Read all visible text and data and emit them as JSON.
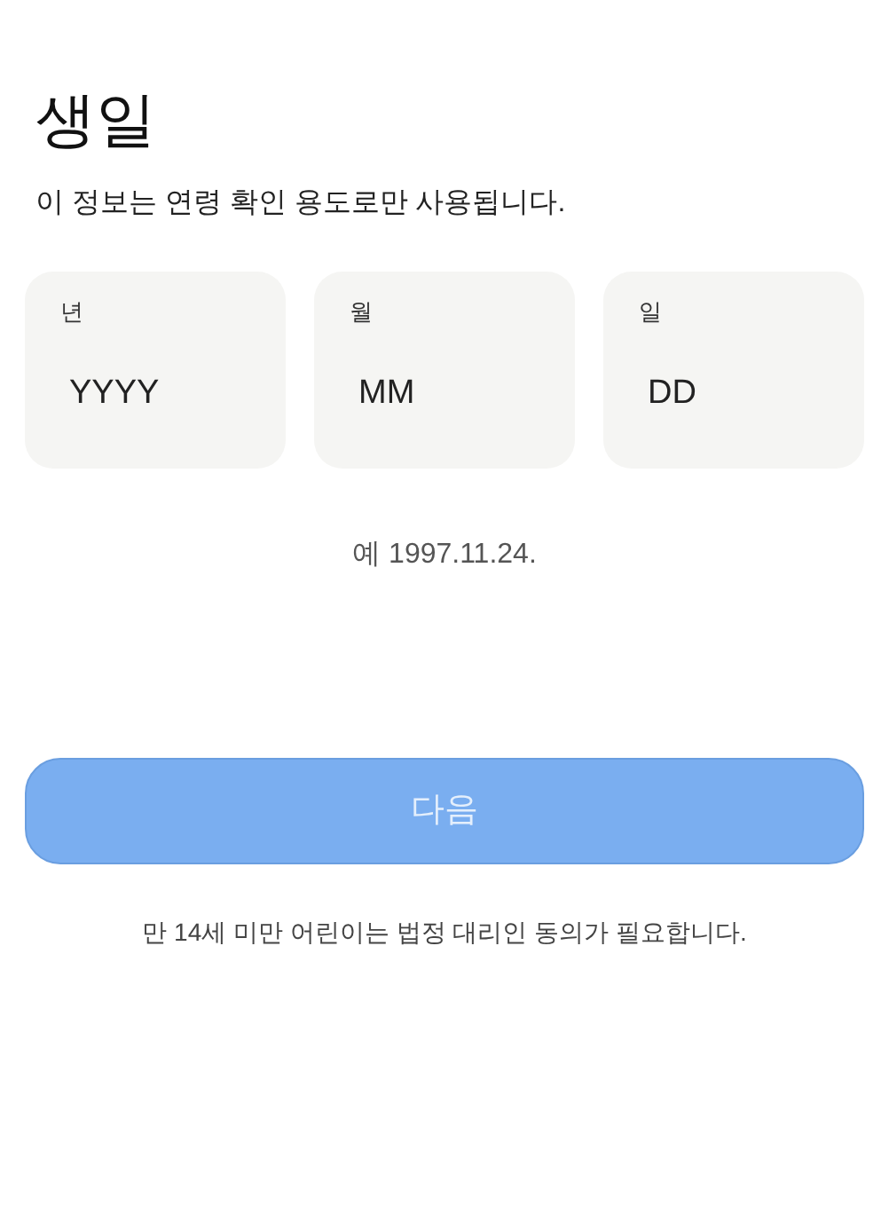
{
  "title": "생일",
  "description": "이 정보는 연령 확인 용도로만 사용됩니다.",
  "fields": [
    {
      "label": "년",
      "placeholder": "YYYY"
    },
    {
      "label": "월",
      "placeholder": "MM"
    },
    {
      "label": "일",
      "placeholder": "DD"
    }
  ],
  "example": "예 1997.11.24.",
  "next_button": {
    "label": "다음",
    "disabled": true
  },
  "notice": "만 14세 미만 어린이는 법정 대리인 동의가 필요합니다."
}
